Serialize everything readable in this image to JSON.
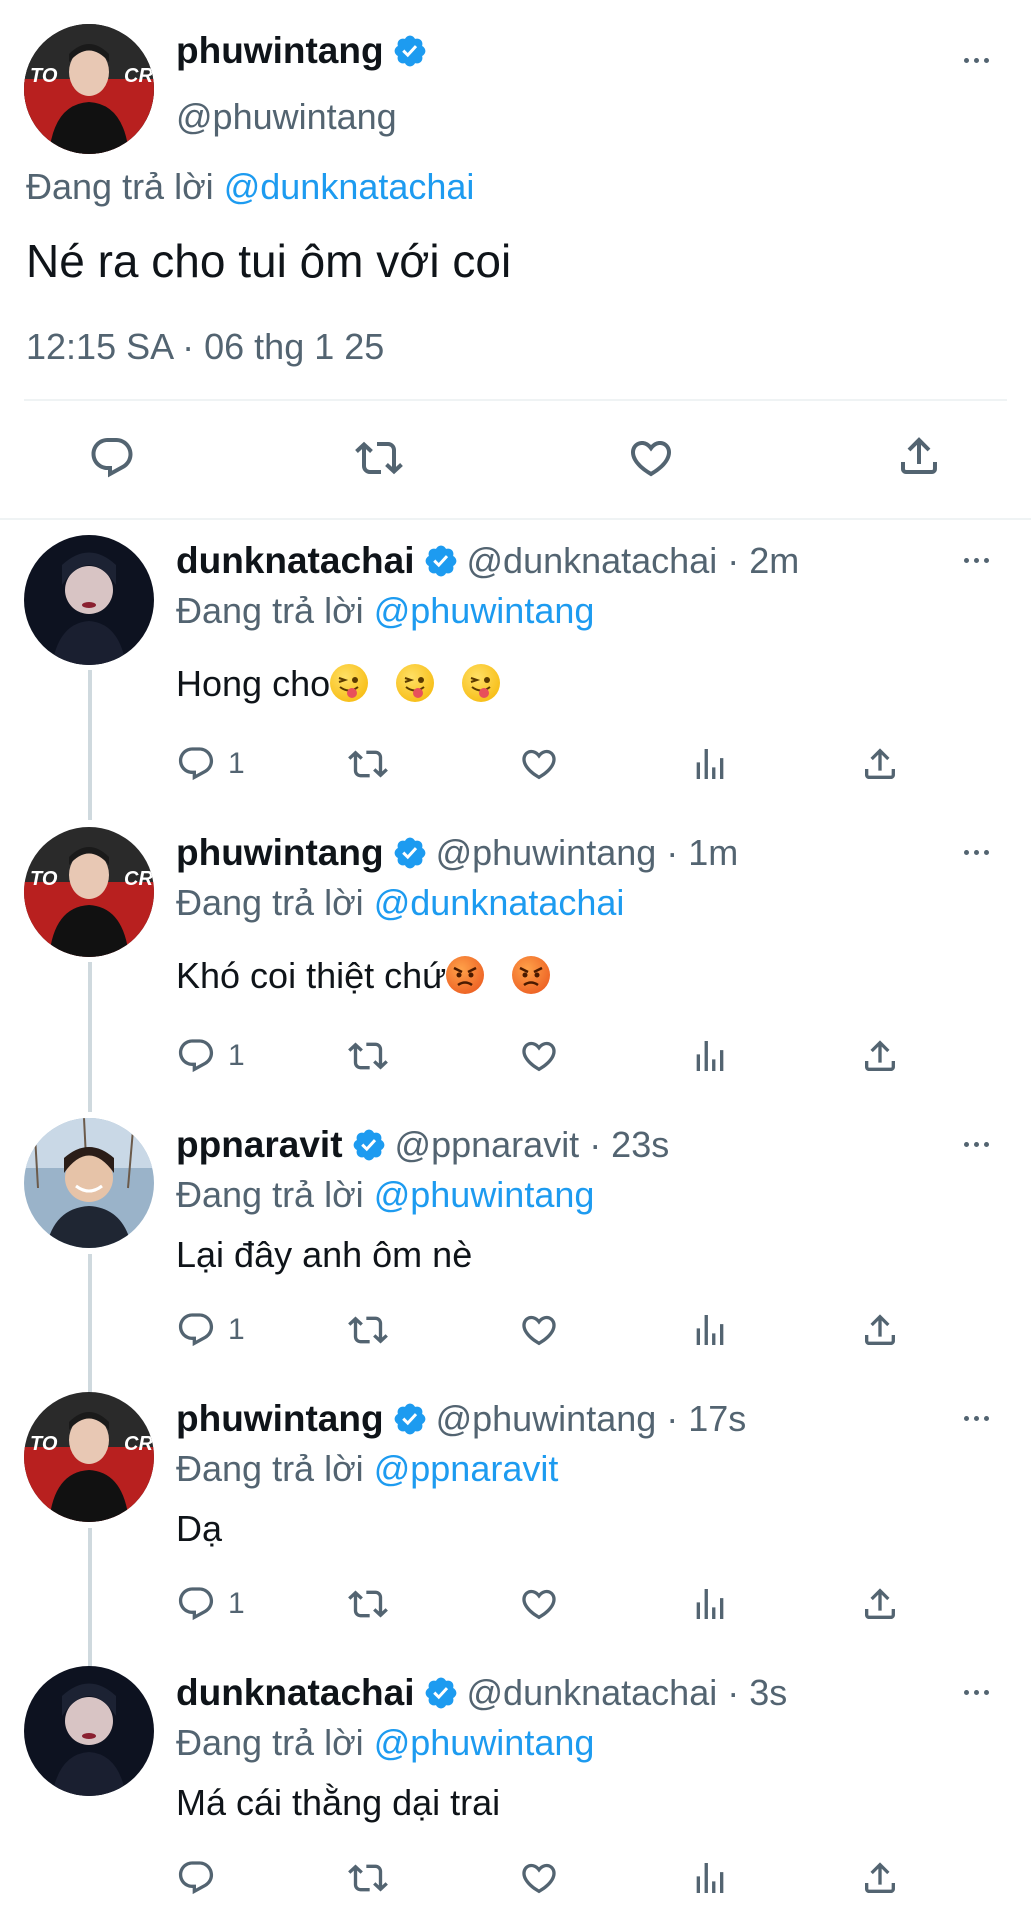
{
  "main_tweet": {
    "name": "phuwintang",
    "handle": "@phuwintang",
    "reply_prefix": "Đang trả lời",
    "reply_to": "@dunknatachai",
    "text": "Né ra cho tui ôm với coi",
    "timestamp": "12:15 SA · 06 thg 1 25"
  },
  "replies": [
    {
      "name": "dunknatachai",
      "meta": "@dunknatachai · 2m",
      "reply_prefix": "Đang trả lời",
      "reply_to": "@phuwintang",
      "text": "Hong cho",
      "emojis": [
        "squinting-tongue-emoji",
        "squinting-tongue-emoji",
        "squinting-tongue-emoji"
      ],
      "reply_count": "1"
    },
    {
      "name": "phuwintang",
      "meta": "@phuwintang · 1m",
      "reply_prefix": "Đang trả lời",
      "reply_to": "@dunknatachai",
      "text": "Khó coi thiệt chứ",
      "emojis": [
        "angry-face-emoji",
        "angry-face-emoji"
      ],
      "reply_count": "1"
    },
    {
      "name": "ppnaravit",
      "meta": "@ppnaravit · 23s",
      "reply_prefix": "Đang trả lời",
      "reply_to": "@phuwintang",
      "text": "Lại đây anh ôm nè",
      "reply_count": "1"
    },
    {
      "name": "phuwintang",
      "meta": "@phuwintang · 17s",
      "reply_prefix": "Đang trả lời",
      "reply_to": "@ppnaravit",
      "text": "Dạ",
      "reply_count": "1"
    },
    {
      "name": "dunknatachai",
      "meta": "@dunknatachai · 3s",
      "reply_prefix": "Đang trả lời",
      "reply_to": "@phuwintang",
      "text": "Má cái thằng dại trai",
      "reply_count": ""
    }
  ],
  "colors": {
    "accent": "#1d9bf0",
    "muted": "#536471",
    "verified": "#1d9bf0",
    "divider": "#eff3f4",
    "thread_line": "#cfd9de"
  },
  "icons": [
    "reply-icon",
    "retweet-icon",
    "like-icon",
    "views-icon",
    "share-icon",
    "more-icon",
    "verified-badge-icon"
  ]
}
